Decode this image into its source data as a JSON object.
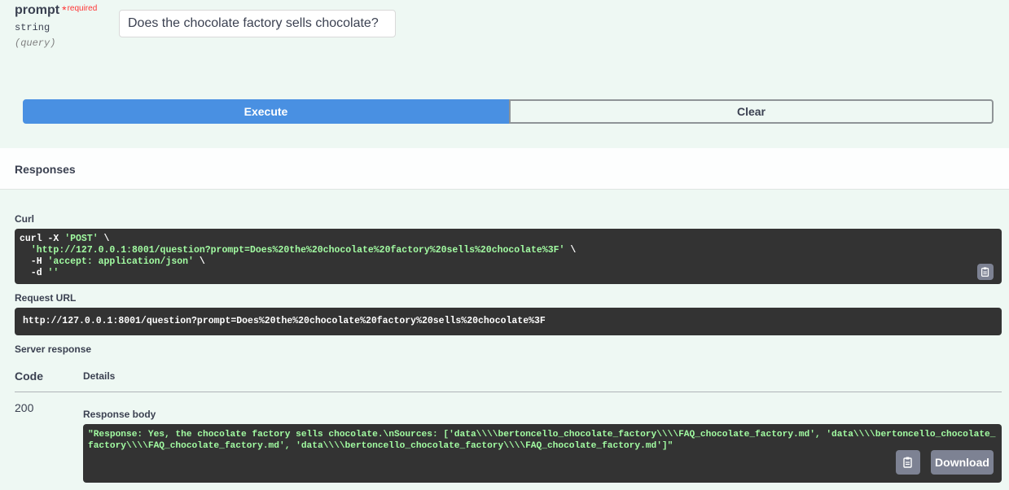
{
  "param": {
    "name": "prompt",
    "star": "*",
    "required": "required",
    "type": "string",
    "in": "(query)",
    "value": "Does the chocolate factory sells chocolate?"
  },
  "buttons": {
    "execute": "Execute",
    "clear": "Clear"
  },
  "responses": {
    "title": "Responses",
    "curl_label": "Curl",
    "curl": {
      "line1_cmd": "curl -X ",
      "line1_method": "'POST'",
      "line1_end": " \\",
      "line2_pre": "  ",
      "line2_url": "'http://127.0.0.1:8001/question?prompt=Does%20the%20chocolate%20factory%20sells%20chocolate%3F'",
      "line2_end": " \\",
      "line3_pre": "  -H ",
      "line3_header": "'accept: application/json'",
      "line3_end": " \\",
      "line4_pre": "  -d ",
      "line4_data": "''"
    },
    "request_url_label": "Request URL",
    "request_url": "http://127.0.0.1:8001/question?prompt=Does%20the%20chocolate%20factory%20sells%20chocolate%3F",
    "server_response_label": "Server response",
    "code_header": "Code",
    "details_header": "Details",
    "status_code": "200",
    "body_label": "Response body",
    "body": "\"Response: Yes, the chocolate factory sells chocolate.\\nSources: ['data\\\\\\\\bertoncello_chocolate_factory\\\\\\\\FAQ_chocolate_factory.md', 'data\\\\\\\\bertoncello_chocolate_factory\\\\\\\\FAQ_chocolate_factory.md', 'data\\\\\\\\bertoncello_chocolate_factory\\\\\\\\FAQ_chocolate_factory.md']\"",
    "download": "Download"
  },
  "colors": {
    "execute_bg": "#4990e2",
    "code_bg": "#333333",
    "code_string": "#a2fca2",
    "required": "#ff3535",
    "page_bg": "#eef8f3"
  },
  "icons": {
    "copy": "clipboard-copy-icon"
  }
}
